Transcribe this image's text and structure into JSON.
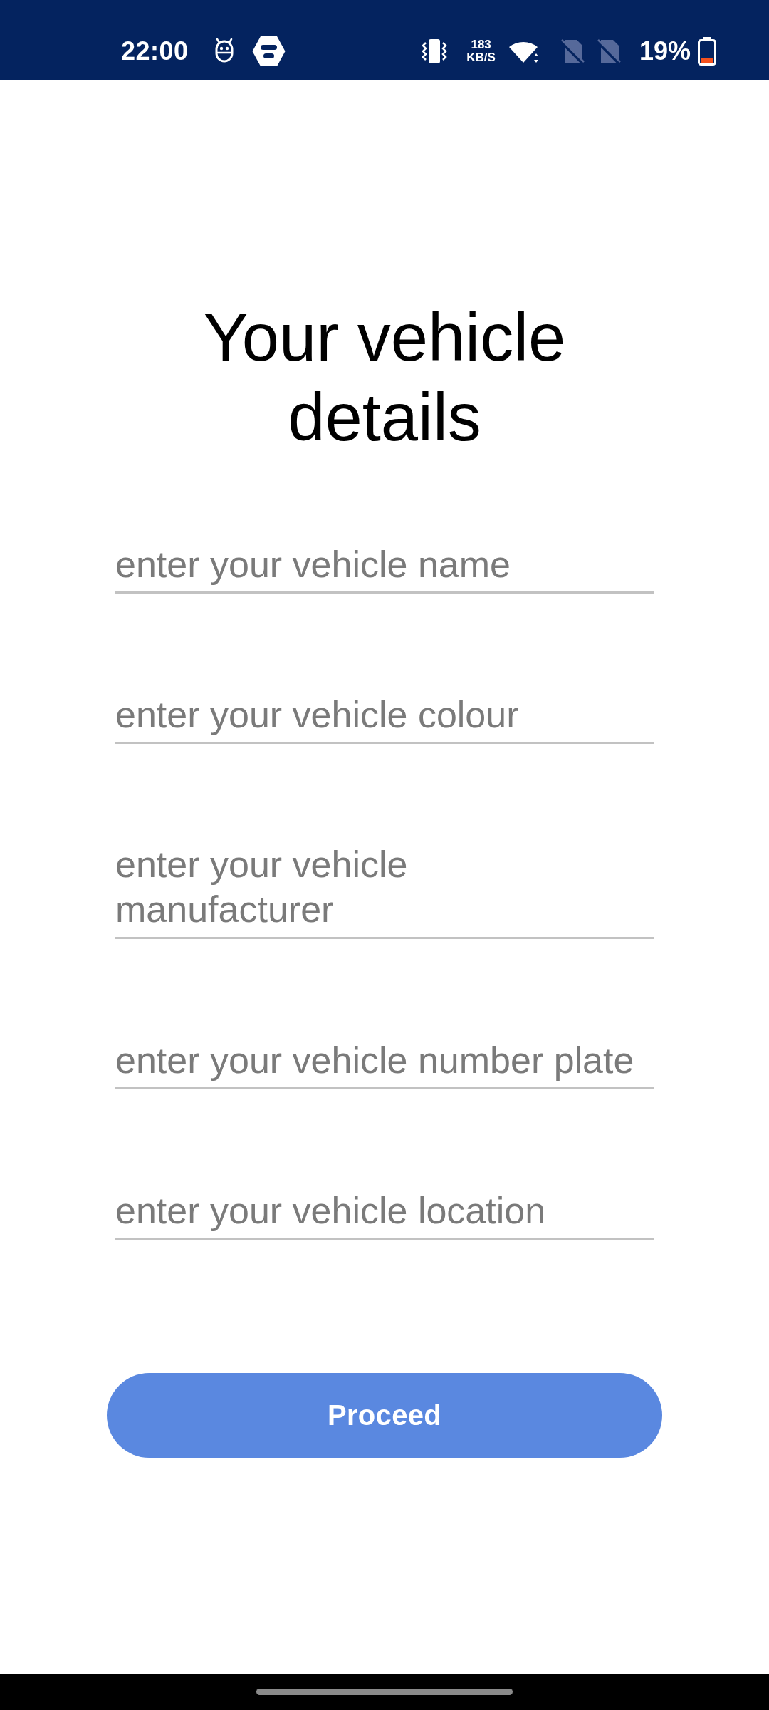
{
  "status_bar": {
    "time": "22:00",
    "network_speed": {
      "value": "183",
      "unit": "KB/S"
    },
    "battery_percent": "19%"
  },
  "title": "Your vehicle details",
  "fields": [
    {
      "kind": "single",
      "placeholder": "enter your vehicle name"
    },
    {
      "kind": "single",
      "placeholder": "enter your vehicle colour"
    },
    {
      "kind": "multiline",
      "placeholder": "enter your vehicle\nmanufacturer"
    },
    {
      "kind": "single",
      "placeholder": "enter your vehicle number plate"
    },
    {
      "kind": "single",
      "placeholder": "enter your vehicle location"
    }
  ],
  "proceed_button": {
    "label": "Proceed"
  }
}
